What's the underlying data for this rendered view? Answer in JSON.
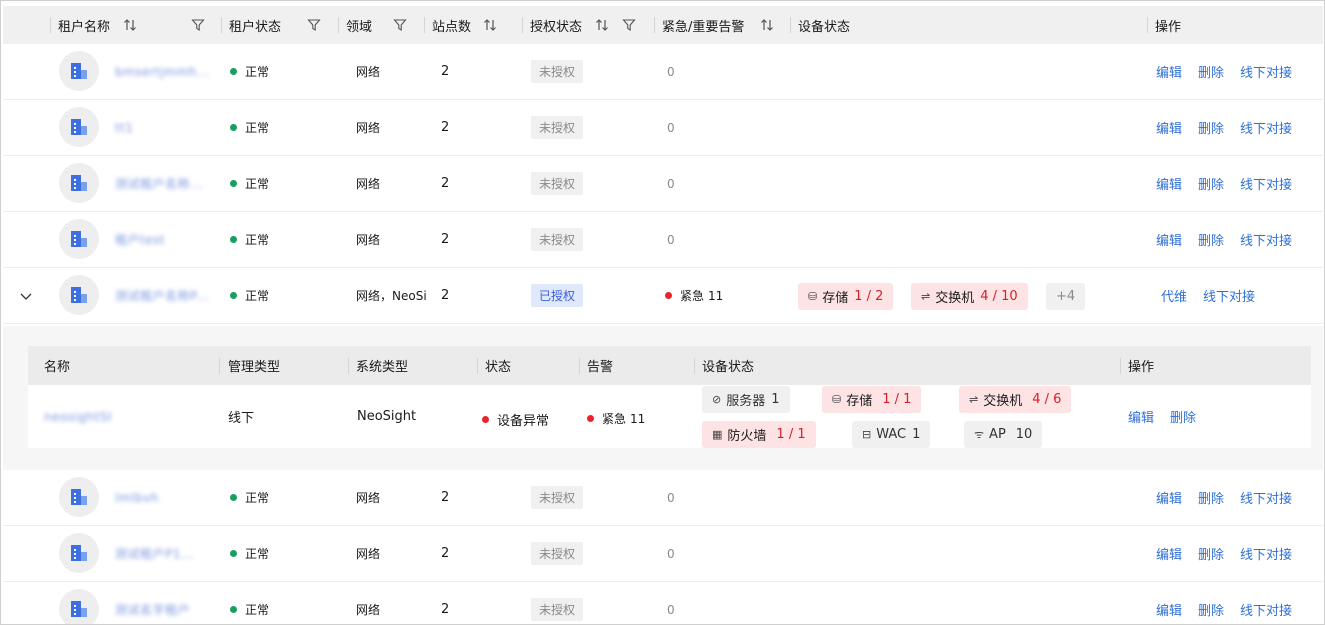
{
  "header": {
    "columns": [
      "租户名称",
      "租户状态",
      "领域",
      "站点数",
      "授权状态",
      "紧急/重要告警",
      "设备状态",
      "操作"
    ],
    "sort_icon": "sort-icon",
    "filter_icon": "filter-icon"
  },
  "colors": {
    "link": "#2e6fd6",
    "normal": "#19a05f",
    "critical": "#e8232e",
    "authorized_tag": "#e0e8fb"
  },
  "rows_top": [
    {
      "name": "bmsertjmmh...",
      "status": "正常",
      "domain": "网络",
      "sites": "2",
      "auth": "未授权",
      "alarm": "0",
      "actions": [
        "编辑",
        "删除",
        "线下对接"
      ]
    },
    {
      "name": "tt1",
      "status": "正常",
      "domain": "网络",
      "sites": "2",
      "auth": "未授权",
      "alarm": "0",
      "actions": [
        "编辑",
        "删除",
        "线下对接"
      ]
    },
    {
      "name": "测试租户名称...",
      "status": "正常",
      "domain": "网络",
      "sites": "2",
      "auth": "未授权",
      "alarm": "0",
      "actions": [
        "编辑",
        "删除",
        "线下对接"
      ]
    },
    {
      "name": "租户test",
      "status": "正常",
      "domain": "网络",
      "sites": "2",
      "auth": "未授权",
      "alarm": "0",
      "actions": [
        "编辑",
        "删除",
        "线下对接"
      ]
    }
  ],
  "row_expanded": {
    "name": "测试租户名称P...",
    "status": "正常",
    "domain": "网络，NeoSi",
    "sites": "2",
    "auth": "已授权",
    "alarm_label": "紧急",
    "alarm_count": "11",
    "devices": [
      {
        "label": "存储",
        "value": "1 / 2",
        "icon": "storage-icon"
      },
      {
        "label": "交换机",
        "value": "4 / 10",
        "icon": "switch-icon"
      }
    ],
    "more": "+4",
    "actions": [
      "代维",
      "线下对接"
    ]
  },
  "subtable": {
    "columns": [
      "名称",
      "管理类型",
      "系统类型",
      "状态",
      "告警",
      "设备状态",
      "操作"
    ],
    "row": {
      "name": "neosightSI",
      "mgmt": "线下",
      "system": "NeoSight",
      "state": "设备异常",
      "alarm_label": "紧急",
      "alarm_count": "11",
      "devices": [
        {
          "label": "服务器",
          "value": "1",
          "icon": "server-icon",
          "abnormal": false
        },
        {
          "label": "存储",
          "value": "1  / 1",
          "icon": "storage-icon",
          "abnormal": true
        },
        {
          "label": "交换机",
          "value": "4  / 6",
          "icon": "switch-icon",
          "abnormal": true
        },
        {
          "label": "防火墙",
          "value": "1  / 1",
          "icon": "firewall-icon",
          "abnormal": true
        },
        {
          "label": "WAC",
          "value": "1",
          "icon": "wac-icon",
          "abnormal": false
        },
        {
          "label": "AP",
          "value": "10",
          "icon": "wifi-icon",
          "abnormal": false
        }
      ],
      "actions": [
        "编辑",
        "删除"
      ]
    }
  },
  "rows_bottom": [
    {
      "name": "lmlbvh",
      "status": "正常",
      "domain": "网络",
      "sites": "2",
      "auth": "未授权",
      "alarm": "0",
      "actions": [
        "编辑",
        "删除",
        "线下对接"
      ]
    },
    {
      "name": "测试租户P1...",
      "status": "正常",
      "domain": "网络",
      "sites": "2",
      "auth": "未授权",
      "alarm": "0",
      "actions": [
        "编辑",
        "删除",
        "线下对接"
      ]
    },
    {
      "name": "测试名字租户",
      "status": "正常",
      "domain": "网络",
      "sites": "2",
      "auth": "未授权",
      "alarm": "0",
      "actions": [
        "编辑",
        "删除",
        "线下对接"
      ]
    }
  ]
}
